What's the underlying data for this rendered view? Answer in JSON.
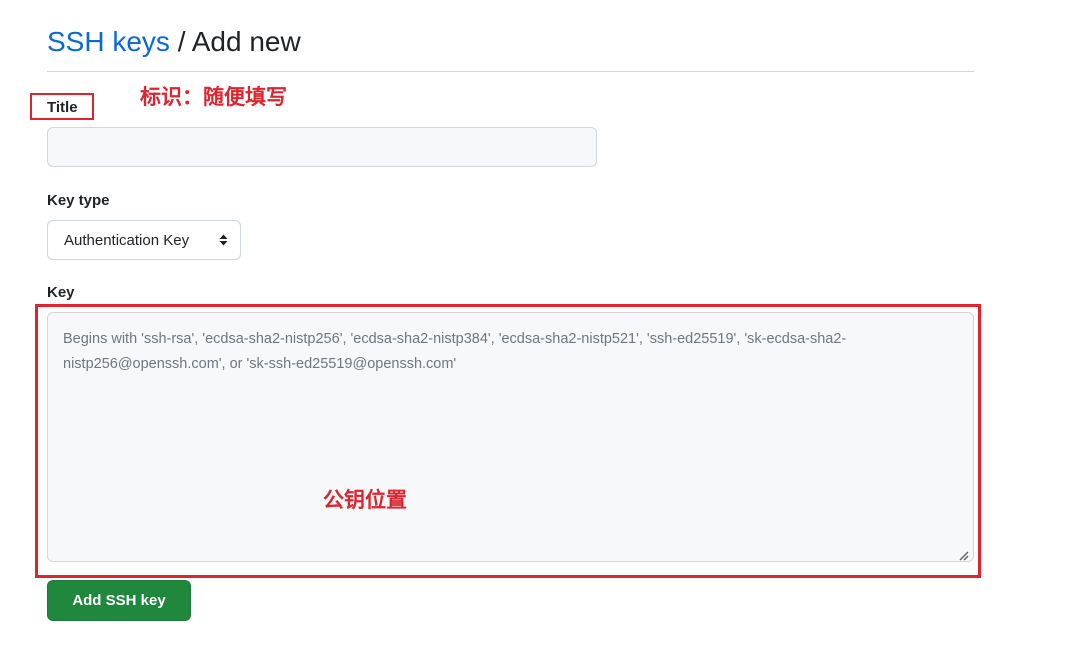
{
  "header": {
    "breadcrumb_link": "SSH keys",
    "separator": "/",
    "current": "Add new"
  },
  "form": {
    "title_label": "Title",
    "title_value": "",
    "key_type_label": "Key type",
    "key_type_selected": "Authentication Key",
    "key_label": "Key",
    "key_placeholder": "Begins with 'ssh-rsa', 'ecdsa-sha2-nistp256', 'ecdsa-sha2-nistp384', 'ecdsa-sha2-nistp521', 'ssh-ed25519', 'sk-ecdsa-sha2-nistp256@openssh.com', or 'sk-ssh-ed25519@openssh.com'",
    "submit_label": "Add SSH key"
  },
  "annotations": {
    "title_note": "标识：随便填写",
    "key_note": "公钥位置",
    "color": "#e0242f"
  },
  "colors": {
    "link": "#0969da",
    "primary_button": "#1f883d",
    "field_bg": "#f6f8fa",
    "border": "#d0d7de"
  },
  "icons": {
    "select_caret": "unfold-caret-icon",
    "resize": "resize-handle-icon"
  }
}
